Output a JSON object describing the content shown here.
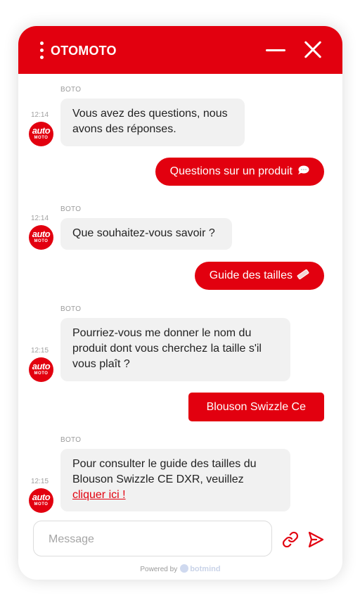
{
  "header": {
    "brand": "OTOMOTO",
    "menu_icon": "kebab-menu-icon",
    "minimize_icon": "minimize-icon",
    "close_icon": "close-icon",
    "color": "#e2000f"
  },
  "messages": [
    {
      "type": "bot",
      "sender": "BOTO",
      "time": "12:14",
      "lines": [
        "Vous avez des questions, nous",
        "avons des réponses."
      ]
    },
    {
      "type": "user",
      "text": "Questions sur un produit",
      "emoji": "speech-bubble-emoji"
    },
    {
      "type": "bot",
      "sender": "BOTO",
      "time": "12:14",
      "lines": [
        "Que souhaitez-vous savoir ?"
      ]
    },
    {
      "type": "user",
      "text": "Guide des tailles",
      "emoji": "ruler-emoji"
    },
    {
      "type": "bot",
      "sender": "BOTO",
      "time": "12:15",
      "lines": [
        "Pourriez-vous me donner le nom du",
        "produit dont vous cherchez la taille s'il",
        "vous plaît ?"
      ]
    },
    {
      "type": "user",
      "text": "Blouson Swizzle Ce"
    },
    {
      "type": "bot",
      "sender": "BOTO",
      "time": "12:15",
      "lines": [
        "Pour consulter le guide des tailles du",
        "Blouson Swizzle CE DXR, veuillez"
      ],
      "link": "cliquer ici !"
    }
  ],
  "avatar": {
    "line1": "auto",
    "line2": "MOTO"
  },
  "composer": {
    "placeholder": "Message",
    "value": "",
    "attach_icon": "link-icon",
    "send_icon": "send-icon"
  },
  "footer": {
    "powered_by": "Powered by",
    "vendor": "botmind"
  }
}
